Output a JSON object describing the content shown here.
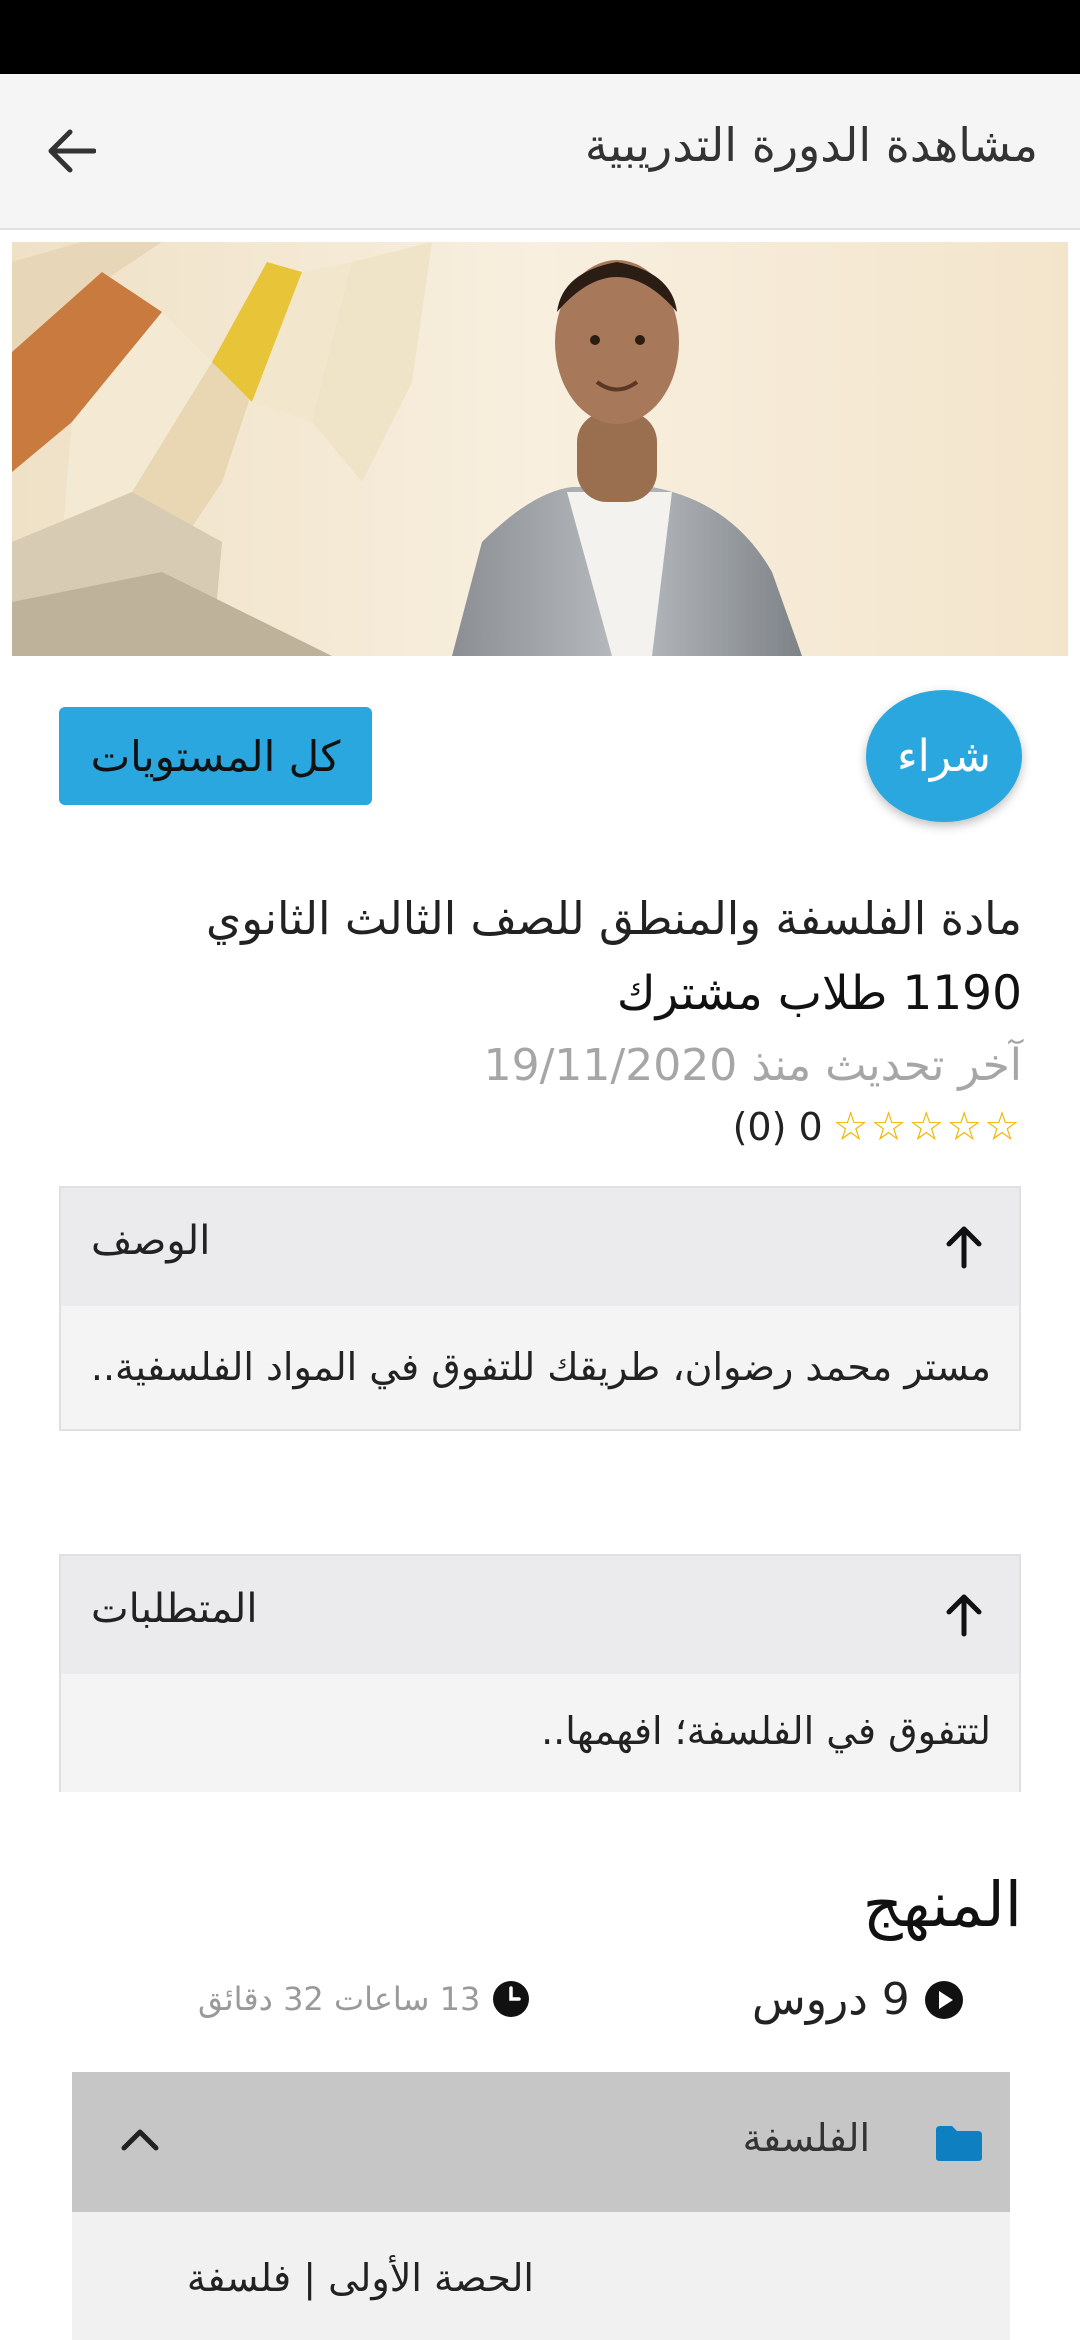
{
  "app_bar": {
    "title": "مشاهدة الدورة التدريبية",
    "back_icon": "arrow-left-icon"
  },
  "actions": {
    "buy_label": "شراء",
    "levels_label": "كل المستويات",
    "accent_color": "#2aa7de"
  },
  "course": {
    "title": "مادة الفلسفة والمنطق للصف الثالث الثانوي",
    "students": "1190 طلاب مشترك",
    "updated": "آخر تحديث منذ 19/11/2020",
    "stars": "☆☆☆☆☆",
    "rating_text": "(0) 0"
  },
  "description": {
    "header": "الوصف",
    "body": "مستر محمد رضوان، طريقك للتفوق في المواد الفلسفية.."
  },
  "requirements": {
    "header": "المتطلبات",
    "body": "لتتفوق في الفلسفة؛ افهمها.."
  },
  "curriculum": {
    "title": "المنهج",
    "lessons": "9 دروس",
    "duration": "13 ساعات 32 دقائق",
    "section_name": "الفلسفة",
    "lesson_1": "الحصة الأولى | فلسفة"
  }
}
